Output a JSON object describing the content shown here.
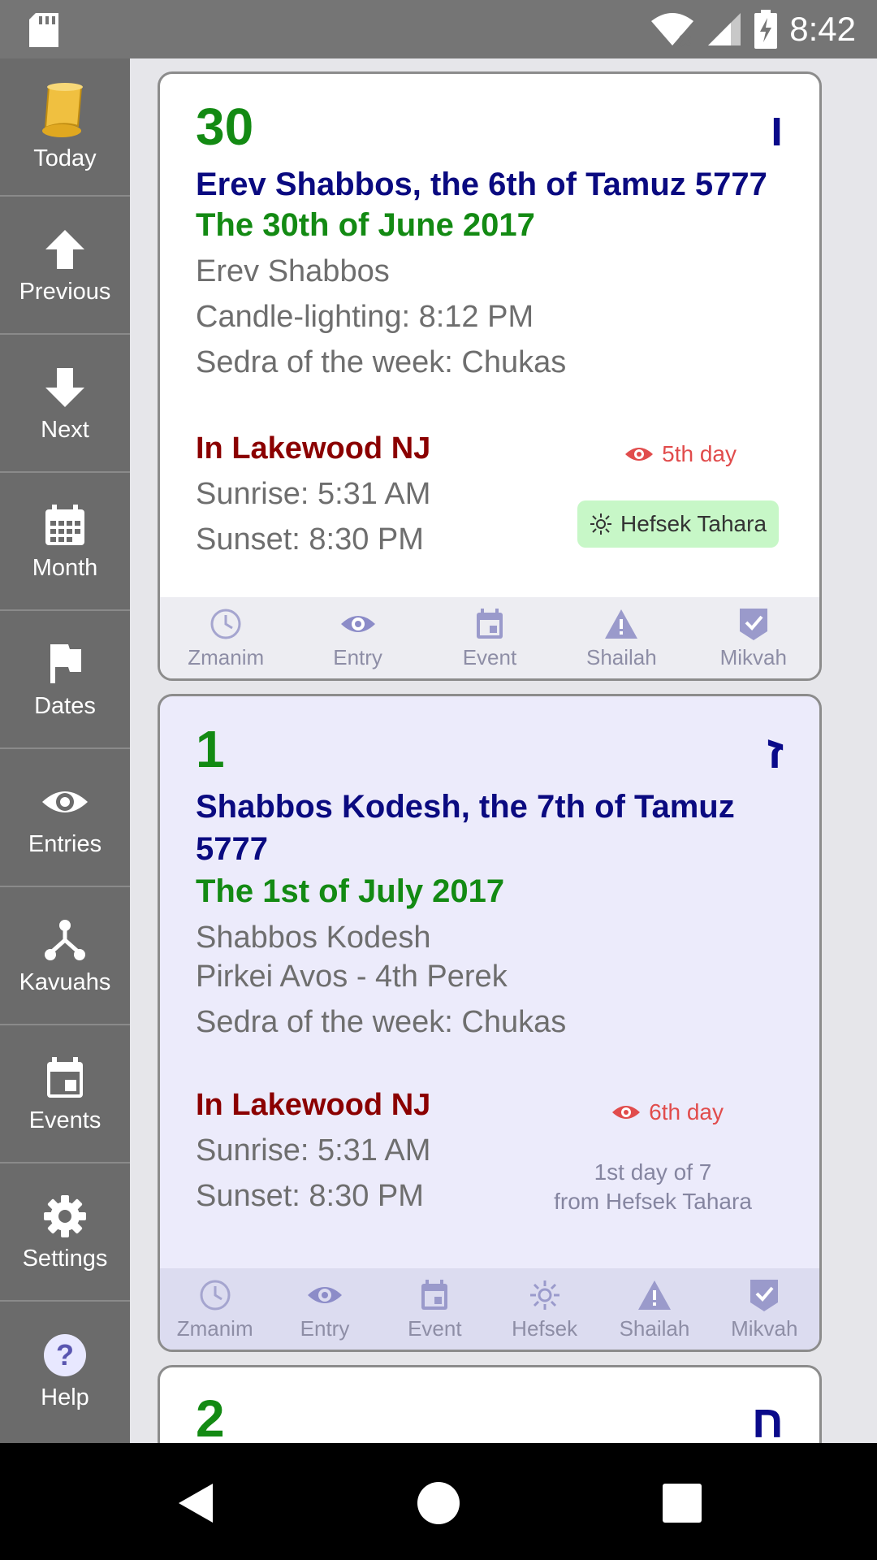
{
  "status_bar": {
    "time": "8:42",
    "icons": [
      "sd-card-icon",
      "wifi-off-icon",
      "cell-signal-icon",
      "battery-charging-icon"
    ]
  },
  "sidebar": {
    "items": [
      {
        "label": "Today",
        "icon": "scroll-icon"
      },
      {
        "label": "Previous",
        "icon": "arrow-up-icon"
      },
      {
        "label": "Next",
        "icon": "arrow-down-icon"
      },
      {
        "label": "Month",
        "icon": "calendar-month-icon"
      },
      {
        "label": "Dates",
        "icon": "flag-icon"
      },
      {
        "label": "Entries",
        "icon": "eye-icon"
      },
      {
        "label": "Kavuahs",
        "icon": "network-icon"
      },
      {
        "label": "Events",
        "icon": "calendar-event-icon"
      },
      {
        "label": "Settings",
        "icon": "gear-icon"
      },
      {
        "label": "Help",
        "icon": "help-icon"
      }
    ]
  },
  "days": [
    {
      "day_number": "30",
      "hebrew_letter": "ו",
      "jewish_date": "Erev Shabbos, the 6th of Tamuz 5777",
      "secular_date": "The 30th of June 2017",
      "notes": [
        "Erev Shabbos",
        "Candle-lighting: 8:12 PM",
        "Sedra of the week: Chukas"
      ],
      "location": "In Lakewood NJ",
      "sunrise": "Sunrise: 5:31 AM",
      "sunset": "Sunset: 8:30 PM",
      "onah": "5th day",
      "badge": "Hefsek Tahara",
      "actions": [
        "Zmanim",
        "Entry",
        "Event",
        "Shailah",
        "Mikvah"
      ]
    },
    {
      "day_number": "1",
      "hebrew_letter": "ז",
      "jewish_date": "Shabbos Kodesh, the 7th of Tamuz 5777",
      "secular_date": "The 1st of July 2017",
      "notes": [
        "Shabbos Kodesh",
        "Pirkei Avos - 4th Perek",
        "Sedra of the week: Chukas"
      ],
      "location": "In Lakewood NJ",
      "sunrise": "Sunrise: 5:31 AM",
      "sunset": "Sunset: 8:30 PM",
      "onah": "6th day",
      "hefsek_note_line1": "1st day of 7",
      "hefsek_note_line2": "from Hefsek Tahara",
      "actions": [
        "Zmanim",
        "Entry",
        "Event",
        "Hefsek",
        "Shailah",
        "Mikvah"
      ]
    },
    {
      "day_number": "2",
      "hebrew_letter": "ח"
    }
  ],
  "colors": {
    "secular_green": "#138a13",
    "jewish_blue": "#0a0a80",
    "location_red": "#8b0000",
    "onah_red": "#e14c4c",
    "hefsek_badge_bg": "#c7f7c7",
    "sidebar_bg": "#6b6b6b"
  }
}
